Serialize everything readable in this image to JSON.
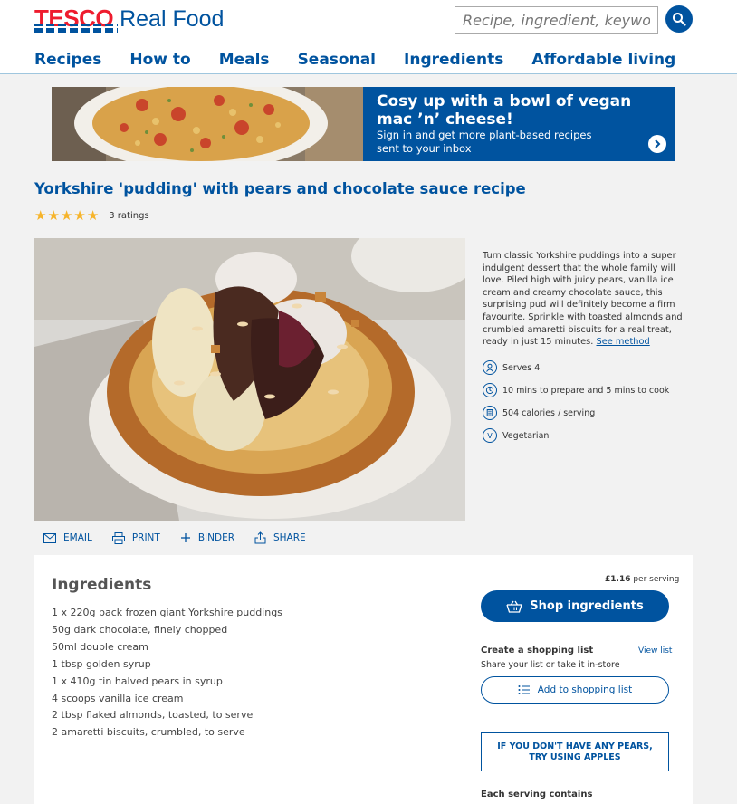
{
  "brand": {
    "name_bold": "TESCO",
    "name_rest": "Real Food"
  },
  "search": {
    "placeholder": "Recipe, ingredient, keyword"
  },
  "nav": [
    {
      "label": "Recipes"
    },
    {
      "label": "How to"
    },
    {
      "label": "Meals"
    },
    {
      "label": "Seasonal"
    },
    {
      "label": "Ingredients"
    },
    {
      "label": "Affordable living"
    }
  ],
  "banner": {
    "title": "Cosy up with a bowl of vegan mac ’n’ cheese!",
    "subtitle": "Sign in and get more plant-based recipes sent to your inbox"
  },
  "recipe": {
    "title": "Yorkshire 'pudding' with pears and chocolate sauce recipe",
    "rating": {
      "stars": 5,
      "text": "3 ratings"
    },
    "description": "Turn classic Yorkshire puddings into a super indulgent dessert that the whole family will love. Piled high with juicy pears, vanilla ice cream and creamy chocolate sauce, this surprising pud will definitely become a firm favourite. Sprinkle with toasted almonds and crumbled amaretti biscuits for a real treat, ready in just 15 minutes.",
    "see_method": "See method",
    "meta": {
      "serves": "Serves 4",
      "time": "10 mins to prepare and 5 mins to cook",
      "calories": "504 calories / serving",
      "diet": "Vegetarian",
      "diet_badge": "V"
    }
  },
  "actions": {
    "email": "EMAIL",
    "print": "PRINT",
    "binder": "BINDER",
    "share": "SHARE"
  },
  "ingredients": {
    "title": "Ingredients",
    "items": [
      "1 x 220g pack frozen giant Yorkshire puddings",
      "50g dark chocolate, finely chopped",
      "50ml double cream",
      "1 tbsp golden syrup",
      "1 x 410g tin halved pears in syrup",
      "4 scoops vanilla ice cream",
      "2 tbsp flaked almonds, toasted, to serve",
      "2 amaretti biscuits, crumbled, to serve"
    ]
  },
  "shop": {
    "price": "£1.16",
    "per_serving": "per serving",
    "shop_label": "Shop ingredients",
    "list_title": "Create a shopping list",
    "view_list": "View list",
    "list_sub": "Share your list or take it in-store",
    "add_label": "Add to shopping list",
    "tip": "IF YOU DON'T HAVE ANY PEARS, TRY USING APPLES",
    "each_serving": "Each serving contains"
  },
  "colors": {
    "brand_blue": "#00539f",
    "tesco_red": "#ee1c2e",
    "star": "#f6b42a"
  }
}
